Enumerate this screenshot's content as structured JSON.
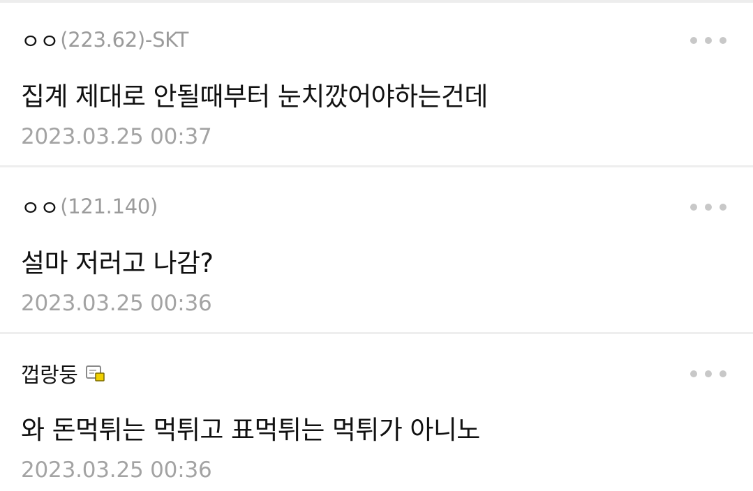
{
  "comments": [
    {
      "author": "ㅇㅇ",
      "ip": "(223.62)-SKT",
      "text": "집계 제대로 안될때부터 눈치깠어야하는건데",
      "date": "2023.03.25 00:37",
      "badge_icon": null
    },
    {
      "author": "ㅇㅇ",
      "ip": "(121.140)",
      "text": "설마 저러고 나감?",
      "date": "2023.03.25 00:36",
      "badge_icon": null
    },
    {
      "author": "껍랑둥",
      "ip": "",
      "text": "와 돈먹튀는 먹튀고 표먹튀는 먹튀가 아니노",
      "date": "2023.03.25 00:36",
      "badge_icon": "fixed-nick-icon"
    }
  ],
  "more_icon": "more-dots-icon",
  "colors": {
    "text": "#111111",
    "ip": "#9b9b9b",
    "date": "#a3a3a3",
    "dots": "#c8c8c8",
    "divider": "#eeeeee",
    "badge_accent": "#f0d000"
  }
}
